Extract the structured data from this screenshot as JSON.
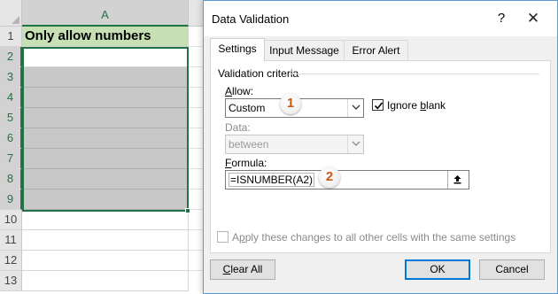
{
  "spreadsheet": {
    "column_header": "A",
    "row_numbers": [
      "1",
      "2",
      "3",
      "4",
      "5",
      "6",
      "7",
      "8",
      "9",
      "10",
      "11",
      "12",
      "13"
    ],
    "cell_a1": "Only allow numbers"
  },
  "dialog": {
    "title": "Data Validation",
    "help_glyph": "?",
    "close_glyph": "✕",
    "tabs": [
      "Settings",
      "Input Message",
      "Error Alert"
    ],
    "active_tab": "Settings",
    "group_title": "Validation criteria",
    "allow": {
      "label_u": "A",
      "label_rest": "llow:",
      "value": "Custom"
    },
    "ignore_blank": {
      "label_pre": "Ignore ",
      "label_u": "b",
      "label_rest": "lank",
      "checked": true
    },
    "data": {
      "label": "Data:",
      "value": "between",
      "disabled": true
    },
    "formula": {
      "label_u": "F",
      "label_rest": "ormula:",
      "value": "=ISNUMBER(A2)"
    },
    "apply_all": {
      "label_pre": "A",
      "label_u": "p",
      "label_rest": "ply these changes to all other cells with the same settings",
      "checked": false,
      "disabled": true
    },
    "buttons": {
      "clear_all_u": "C",
      "clear_all_rest": "lear All",
      "ok": "OK",
      "cancel": "Cancel"
    },
    "step_badges": [
      "1",
      "2"
    ]
  },
  "colors": {
    "excel_green": "#217346",
    "header_fill": "#c6e0b4",
    "range_fill": "#c8c8c8",
    "badge_text": "#c65a11",
    "default_button_border": "#0078d7"
  }
}
